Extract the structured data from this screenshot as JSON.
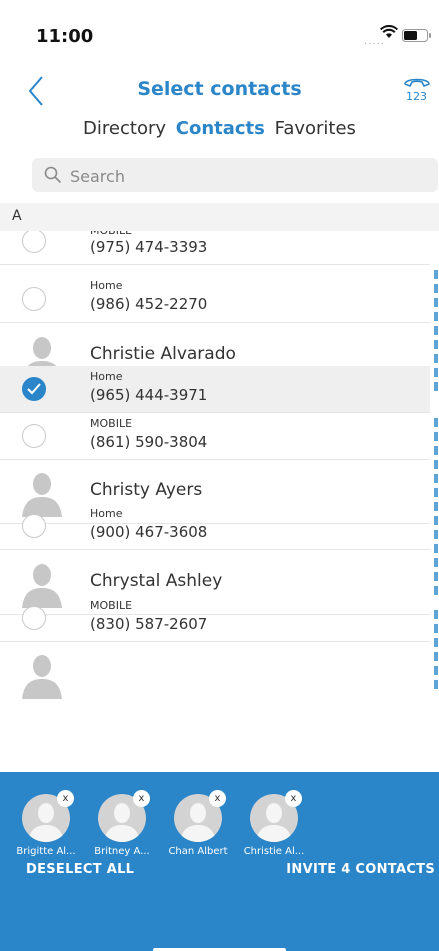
{
  "status_bar": {
    "time": "11:00",
    "signal": "....."
  },
  "header": {
    "title": "Select contacts",
    "dialpad_label": "123"
  },
  "tabs": [
    {
      "label": "Directory",
      "active": false
    },
    {
      "label": "Contacts",
      "active": true
    },
    {
      "label": "Favorites",
      "active": false
    }
  ],
  "search": {
    "placeholder": "Search"
  },
  "section": {
    "letter": "A"
  },
  "rows": [
    {
      "kind": "phone",
      "type": "MOBILE",
      "number": "(975) 474-3393",
      "selected": false
    },
    {
      "kind": "phone",
      "type": "Home",
      "number": "(986) 452-2270",
      "selected": false
    },
    {
      "kind": "contact",
      "name": "Christie Alvarado"
    },
    {
      "kind": "phone",
      "type": "Home",
      "number": "(965) 444-3971",
      "selected": true
    },
    {
      "kind": "phone",
      "type": "MOBILE",
      "number": "(861) 590-3804",
      "selected": false
    },
    {
      "kind": "contact",
      "name": "Christy Ayers"
    },
    {
      "kind": "phone",
      "type": "Home",
      "number": "(900) 467-3608",
      "selected": false
    },
    {
      "kind": "contact",
      "name": "Chrystal Ashley"
    },
    {
      "kind": "phone",
      "type": "MOBILE",
      "number": "(830) 587-2607",
      "selected": false
    }
  ],
  "selected_contacts": [
    {
      "label": "Brigitte Al...",
      "remove": "x"
    },
    {
      "label": "Britney A...",
      "remove": "x"
    },
    {
      "label": "Chan Albert",
      "remove": "x"
    },
    {
      "label": "Christie Al...",
      "remove": "x"
    }
  ],
  "actions": {
    "deselect_all": "DESELECT ALL",
    "invite": "INVITE 4 CONTACTS"
  },
  "colors": {
    "accent": "#2a86c8",
    "selected_row": "#efeff0",
    "avatar": "#d3d3d3"
  }
}
